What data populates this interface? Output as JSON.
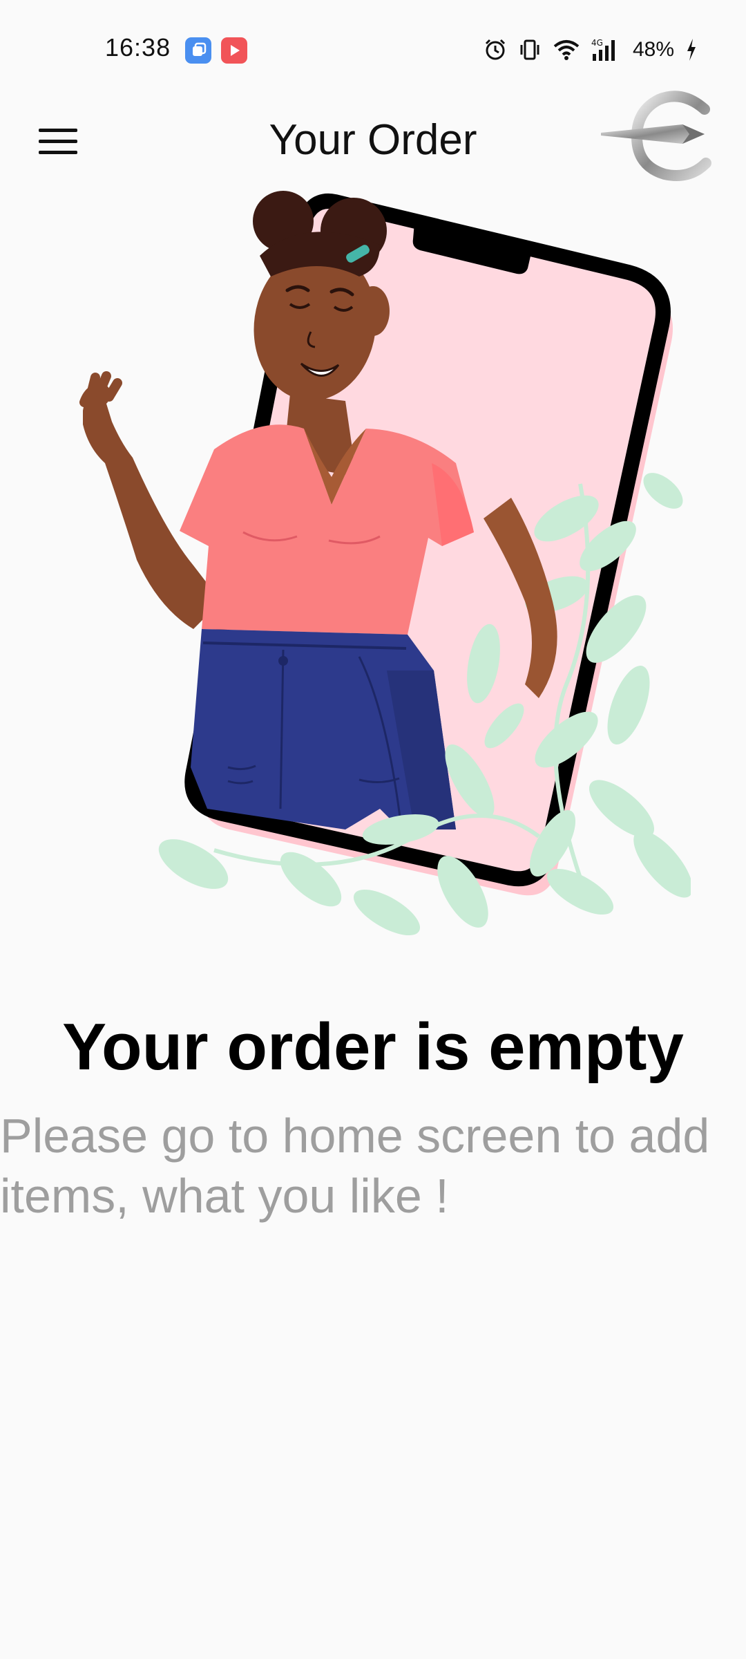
{
  "status_bar": {
    "time": "16:38",
    "battery": "48%",
    "icons": [
      "app-notification-icon",
      "youtube-notification-icon",
      "alarm-icon",
      "vibrate-icon",
      "wifi-icon",
      "signal-4g-icon",
      "battery-charging-icon"
    ]
  },
  "app_bar": {
    "title": "Your Order",
    "menu_icon": "hamburger-menu-icon",
    "logo_icon": "brand-logo-icon"
  },
  "empty_state": {
    "title": "Your order is empty",
    "message": "Please go to home screen to add items, what you like !"
  },
  "colors": {
    "background": "#fafafa",
    "title": "#000000",
    "message": "#9e9e9e",
    "shirt": "#fa7f80",
    "jeans": "#2d3a8c",
    "phone_screen": "#ffd9e0",
    "leaves": "#c9ecd6"
  }
}
